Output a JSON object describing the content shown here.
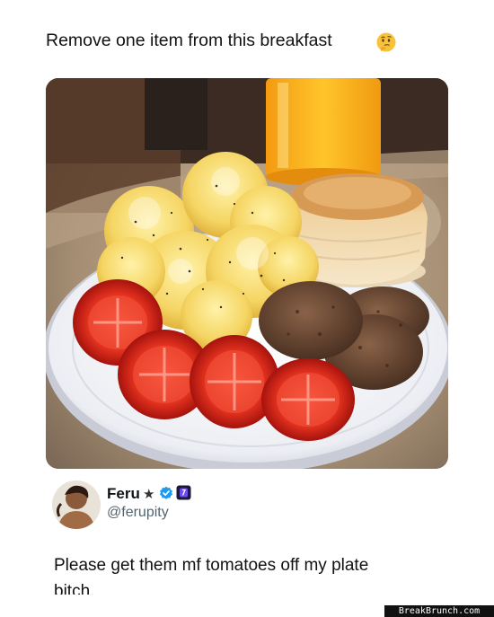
{
  "post": {
    "text": "Remove one item from this breakfast",
    "emoji_icon": "thinking-face-icon"
  },
  "photo": {
    "items": [
      "orange-juice",
      "scrambled-eggs",
      "biscuit",
      "sausage-patties",
      "tomato-slices"
    ],
    "colors": {
      "counter": "#9c866f",
      "plate": "#f3f4f8",
      "eggs": "#f4d26a",
      "biscuit": "#e8c98f",
      "sausage": "#6b4a36",
      "tomato": "#d8261f",
      "juice": "#f7b21a"
    }
  },
  "reply": {
    "display_name": "Feru",
    "star": "★",
    "handle": "@ferupity",
    "text": "Please get them mf tomatoes off my plate bitch.",
    "badges": [
      "verified-badge-icon",
      "affiliate-badge-icon"
    ]
  },
  "watermark": {
    "text": "BreakBrunch.com"
  }
}
